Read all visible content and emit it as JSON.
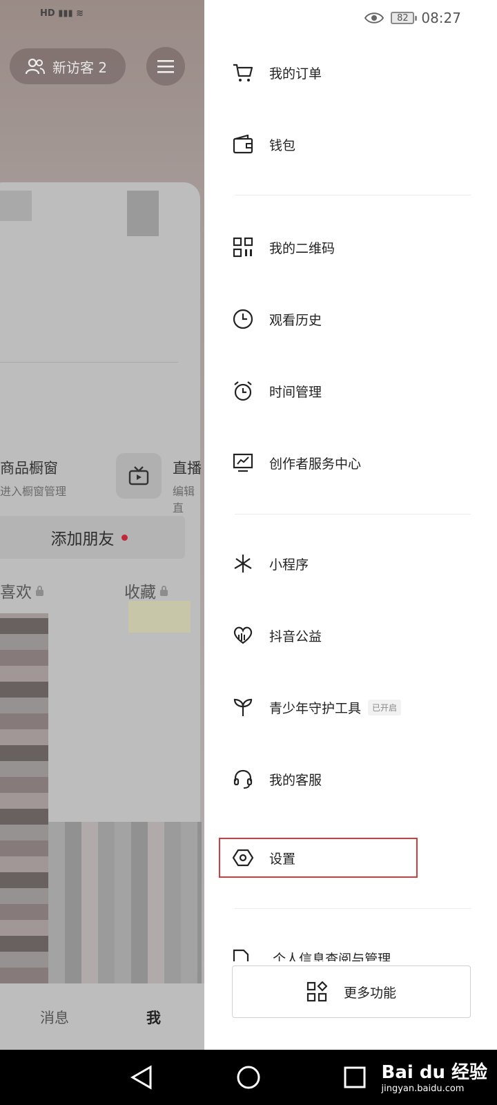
{
  "background_page": {
    "visitor_label": "新访客 2",
    "shop_window_title": "商品橱窗",
    "shop_window_sub": "进入橱窗管理",
    "live_title": "直播",
    "live_sub": "编辑直",
    "add_friend_label": "添加朋友",
    "tab_likes": "喜欢",
    "tab_favorites": "收藏",
    "bottom_nav": {
      "messages": "消息",
      "me": "我"
    }
  },
  "status_bar": {
    "battery": "82",
    "time": "08:27"
  },
  "drawer": {
    "items": [
      {
        "label": "我的订单",
        "icon": "cart-icon"
      },
      {
        "label": "钱包",
        "icon": "wallet-icon"
      },
      {
        "label": "我的二维码",
        "icon": "qrcode-icon"
      },
      {
        "label": "观看历史",
        "icon": "clock-icon"
      },
      {
        "label": "时间管理",
        "icon": "alarm-icon"
      },
      {
        "label": "创作者服务中心",
        "icon": "chart-monitor-icon"
      },
      {
        "label": "小程序",
        "icon": "mini-program-icon"
      },
      {
        "label": "抖音公益",
        "icon": "charity-heart-icon"
      },
      {
        "label": "青少年守护工具",
        "icon": "sprout-icon",
        "badge": "已开启"
      },
      {
        "label": "我的客服",
        "icon": "headset-icon"
      },
      {
        "label": "设置",
        "icon": "settings-hexagon-icon"
      }
    ],
    "partial_item_label": "个人信息查阅与管理",
    "more_button_label": "更多功能"
  },
  "watermark": {
    "brand": "Bai du 经验",
    "url": "jingyan.baidu.com"
  },
  "colors": {
    "highlight": "#d53b3b",
    "dot": "#c0283a"
  }
}
